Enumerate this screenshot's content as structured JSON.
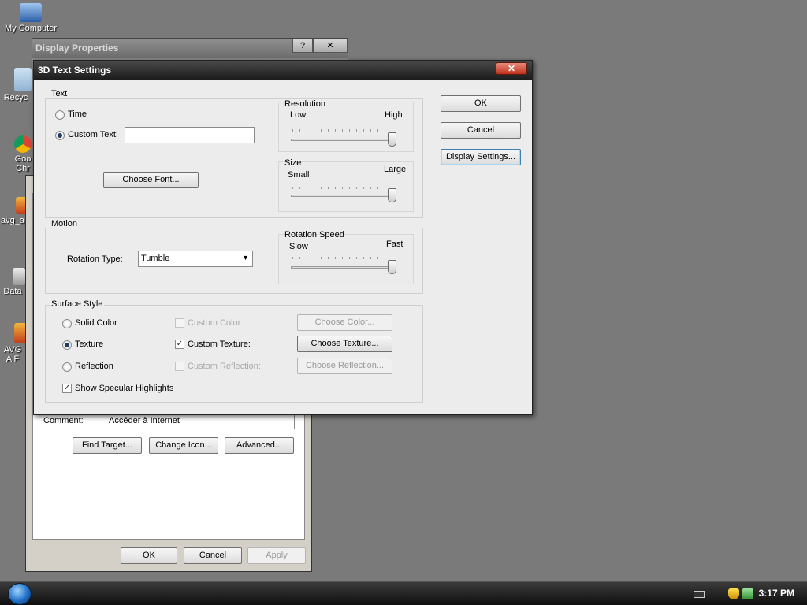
{
  "desktop": {
    "icons": [
      {
        "label": "My Computer"
      },
      {
        "label": "Recyc"
      },
      {
        "label": "Goo Chr"
      },
      {
        "label": "avg_a"
      },
      {
        "label": "Data"
      },
      {
        "label": "AVG A F"
      }
    ]
  },
  "display_properties": {
    "title": "Display Properties",
    "help_label": "?",
    "close_label": "✕"
  },
  "shortcut_props": {
    "comment_label": "Comment:",
    "comment_value": "Accéder à Internet",
    "find_target_label": "Find Target...",
    "change_icon_label": "Change Icon...",
    "advanced_label": "Advanced...",
    "ok_label": "OK",
    "cancel_label": "Cancel",
    "apply_label": "Apply"
  },
  "dialog": {
    "title": "3D Text Settings",
    "close_label": "✕",
    "ok_label": "OK",
    "cancel_label": "Cancel",
    "display_settings_label": "Display Settings...",
    "text_group": {
      "label": "Text",
      "time_label": "Time",
      "custom_text_label": "Custom Text:",
      "custom_text_value": "",
      "choose_font_label": "Choose Font...",
      "selected": "custom"
    },
    "resolution": {
      "label": "Resolution",
      "min_label": "Low",
      "max_label": "High",
      "value": 1.0
    },
    "size": {
      "label": "Size",
      "min_label": "Small",
      "max_label": "Large",
      "value": 1.0
    },
    "motion_group": {
      "label": "Motion",
      "rotation_type_label": "Rotation Type:",
      "rotation_type_value": "Tumble"
    },
    "rotation_speed": {
      "label": "Rotation Speed",
      "min_label": "Slow",
      "max_label": "Fast",
      "value": 1.0
    },
    "surface_group": {
      "label": "Surface Style",
      "solid_color_label": "Solid Color",
      "texture_label": "Texture",
      "reflection_label": "Reflection",
      "selected": "texture",
      "custom_color_label": "Custom Color",
      "custom_texture_label": "Custom Texture:",
      "custom_reflection_label": "Custom Reflection:",
      "custom_texture_checked": true,
      "choose_color_label": "Choose Color...",
      "choose_texture_label": "Choose Texture...",
      "choose_reflection_label": "Choose Reflection...",
      "specular_label": "Show Specular Highlights",
      "specular_checked": true
    }
  },
  "taskbar": {
    "clock": "3:17 PM"
  }
}
